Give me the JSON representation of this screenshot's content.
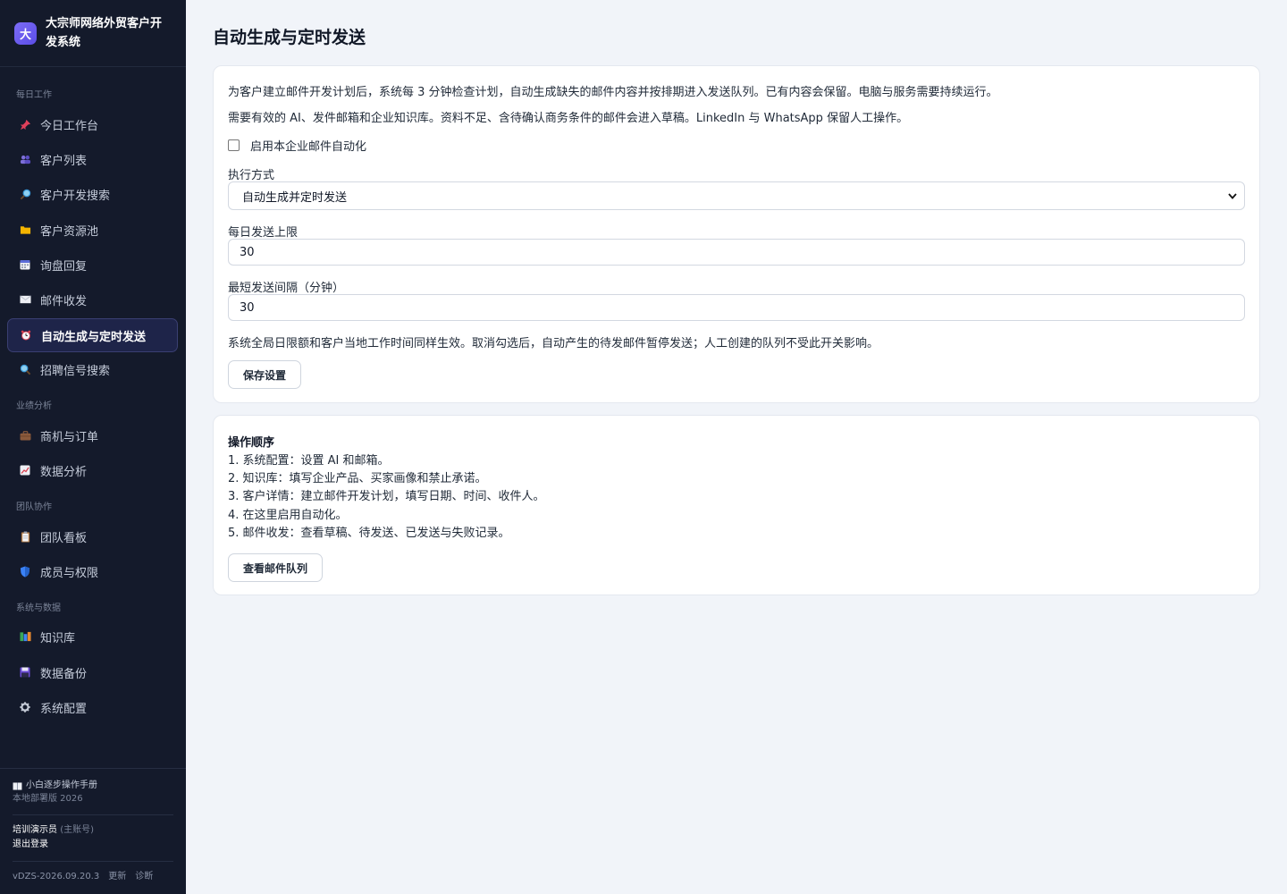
{
  "brand": {
    "logo_char": "大",
    "title": "大宗师网络外贸客户开发系统"
  },
  "sidebar": {
    "sections": [
      {
        "label": "每日工作",
        "items": [
          {
            "label": "今日工作台",
            "icon": "pin-icon"
          },
          {
            "label": "客户列表",
            "icon": "users-icon"
          },
          {
            "label": "客户开发搜索",
            "icon": "magnifier-icon"
          },
          {
            "label": "客户资源池",
            "icon": "folder-icon"
          },
          {
            "label": "询盘回复",
            "icon": "calendar-icon"
          },
          {
            "label": "邮件收发",
            "icon": "envelope-icon"
          },
          {
            "label": "自动生成与定时发送",
            "icon": "alarm-clock-icon",
            "active": true
          },
          {
            "label": "招聘信号搜索",
            "icon": "search-icon"
          }
        ]
      },
      {
        "label": "业绩分析",
        "items": [
          {
            "label": "商机与订单",
            "icon": "briefcase-icon"
          },
          {
            "label": "数据分析",
            "icon": "chart-icon"
          }
        ]
      },
      {
        "label": "团队协作",
        "items": [
          {
            "label": "团队看板",
            "icon": "clipboard-icon"
          },
          {
            "label": "成员与权限",
            "icon": "shield-icon"
          }
        ]
      },
      {
        "label": "系统与数据",
        "items": [
          {
            "label": "知识库",
            "icon": "books-icon"
          },
          {
            "label": "数据备份",
            "icon": "floppy-icon"
          },
          {
            "label": "系统配置",
            "icon": "gear-icon"
          }
        ]
      }
    ],
    "footer": {
      "manual_label": "小白逐步操作手册",
      "edition": "本地部署版 2026",
      "user_name": "培训演示员",
      "user_role": "(主账号)",
      "logout": "退出登录",
      "version": "vDZS-2026.09.20.3",
      "update": "更新",
      "diagnose": "诊断"
    }
  },
  "main": {
    "title": "自动生成与定时发送",
    "settings": {
      "intro1": "为客户建立邮件开发计划后，系统每 3 分钟检查计划，自动生成缺失的邮件内容并按排期进入发送队列。已有内容会保留。电脑与服务需要持续运行。",
      "intro2": "需要有效的 AI、发件邮箱和企业知识库。资料不足、含待确认商务条件的邮件会进入草稿。LinkedIn 与 WhatsApp 保留人工操作。",
      "enable_label": "启用本企业邮件自动化",
      "enable_checked": false,
      "mode_label": "执行方式",
      "mode_value": "自动生成并定时发送",
      "daily_limit_label": "每日发送上限",
      "daily_limit_value": "30",
      "interval_label": "最短发送间隔（分钟）",
      "interval_value": "30",
      "note": "系统全局日限额和客户当地工作时间同样生效。取消勾选后，自动产生的待发邮件暂停发送；人工创建的队列不受此开关影响。",
      "save_button": "保存设置"
    },
    "steps": {
      "title": "操作顺序",
      "items": [
        "1. 系统配置：设置 AI 和邮箱。",
        "2. 知识库：填写企业产品、买家画像和禁止承诺。",
        "3. 客户详情：建立邮件开发计划，填写日期、时间、收件人。",
        "4. 在这里启用自动化。",
        "5. 邮件收发：查看草稿、待发送、已发送与失败记录。"
      ],
      "queue_button": "查看邮件队列"
    }
  },
  "colors": {
    "sidebar_bg": "#141a2b",
    "accent": "#6d5ef0",
    "active_bg": "#1e2449",
    "page_bg": "#f1f4f9"
  }
}
